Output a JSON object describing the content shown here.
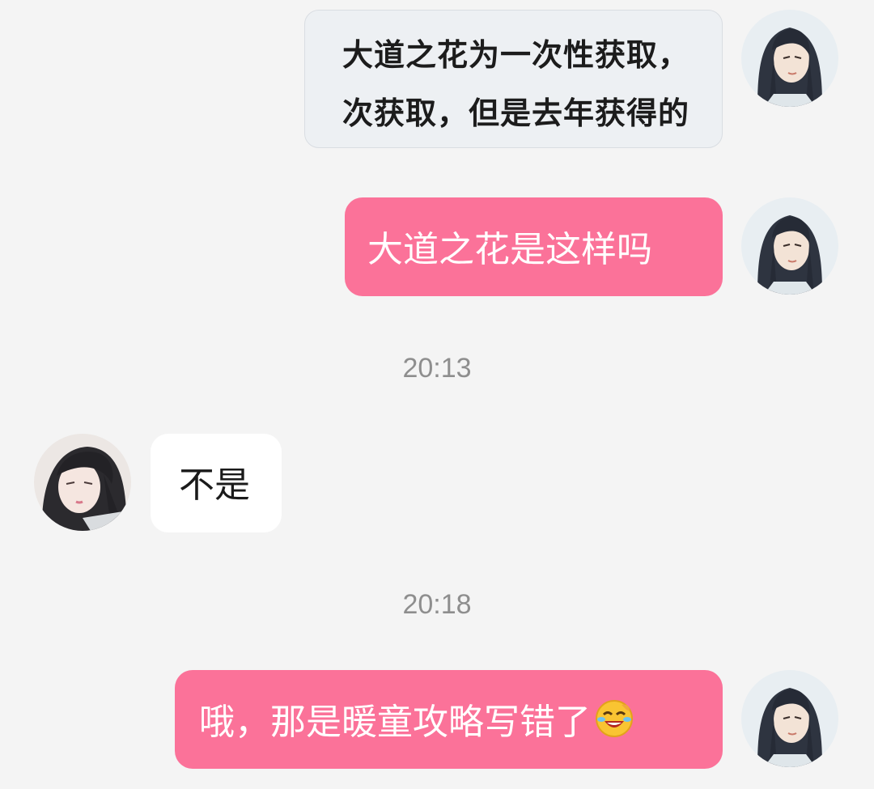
{
  "messages": [
    {
      "id": "m1",
      "side": "right",
      "type": "image",
      "image_text_lines": [
        "大道之花为一次性获取，",
        "次获取，但是去年获得的"
      ]
    },
    {
      "id": "m2",
      "side": "right",
      "type": "text",
      "text": "大道之花是这样吗"
    },
    {
      "id": "t1",
      "type": "timestamp",
      "text": "20:13"
    },
    {
      "id": "m3",
      "side": "left",
      "type": "text",
      "text": "不是"
    },
    {
      "id": "t2",
      "type": "timestamp",
      "text": "20:18"
    },
    {
      "id": "m4",
      "side": "right",
      "type": "text",
      "text": "哦，那是暖童攻略写错了",
      "emoji": "laughing-tears-emoji"
    }
  ],
  "colors": {
    "background": "#f4f4f4",
    "self_bubble": "#fb7299",
    "self_text": "#ffffff",
    "other_bubble": "#ffffff",
    "other_text": "#1a1a1a",
    "timestamp_text": "#8e8e8e"
  }
}
